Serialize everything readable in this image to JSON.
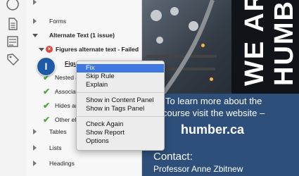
{
  "rail": {
    "icons": [
      "clock-icon",
      "page-icon",
      "compare-icon",
      "tag-icon"
    ]
  },
  "panel": {
    "forms_label": "Forms",
    "alt_text_label": "Alternate Text (1 issue)",
    "figures_failed_label": "Figures alternate text - Failed",
    "figure_item_label": "Figur",
    "nested_label": "Nested a",
    "associated_label": "Associat",
    "hides_label": "Hides an",
    "other_label": "Other ele",
    "tables_label": "Tables",
    "lists_label": "Lists",
    "headings_label": "Headings",
    "cursor_letter": "I"
  },
  "context_menu": {
    "items": [
      "Fix",
      "Skip Rule",
      "Explain",
      "Show in Content Panel",
      "Show in Tags Panel",
      "Check Again",
      "Show Report",
      "Options"
    ],
    "highlighted": "Fix"
  },
  "document": {
    "banner_line1": "WE AR",
    "banner_line2": "HUMB",
    "learn_line1": "To learn more about the",
    "learn_line2": "course visit the website –",
    "website": "humber.ca",
    "contact_heading": "Contact:",
    "contact_name": "Professor Anne Zbitnew"
  },
  "colors": {
    "doc_background": "#2e4f7a",
    "menu_highlight": "#3f78e0",
    "fail_red": "#e0483e",
    "pass_green": "#4aa83a"
  }
}
